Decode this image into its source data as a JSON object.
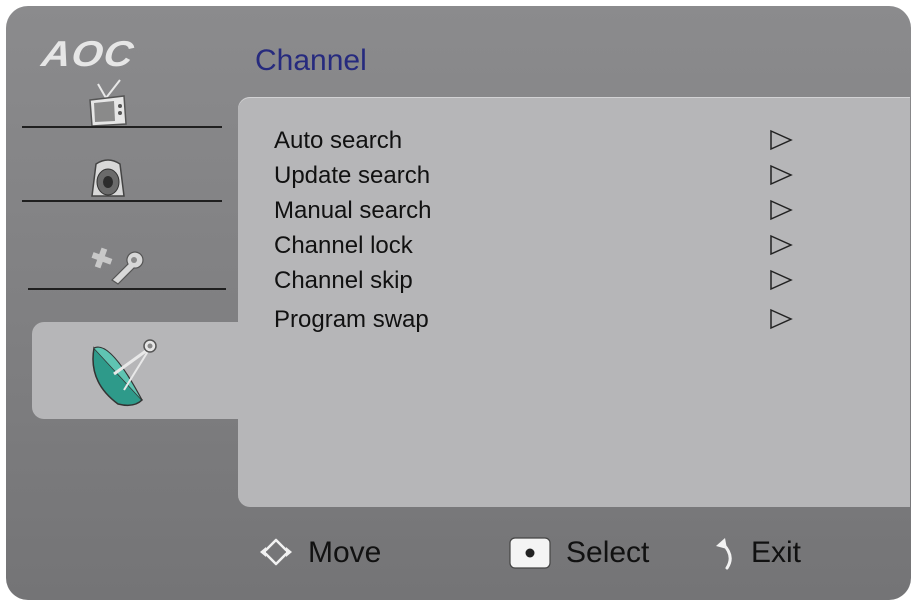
{
  "brand": {
    "logo_text": "AOC"
  },
  "header": {
    "title": "Channel"
  },
  "sidebar": {
    "items": [
      {
        "name": "tv-icon"
      },
      {
        "name": "speaker-icon"
      },
      {
        "name": "tools-icon"
      },
      {
        "name": "satellite-dish-icon",
        "active": true
      }
    ]
  },
  "menu": {
    "items": [
      {
        "label": "Auto search"
      },
      {
        "label": "Update search"
      },
      {
        "label": "Manual search"
      },
      {
        "label": "Channel lock"
      },
      {
        "label": "Channel skip"
      },
      {
        "label": "Program swap"
      }
    ]
  },
  "footer": {
    "move_label": "Move",
    "select_label": "Select",
    "exit_label": "Exit"
  },
  "colors": {
    "background": "#7e7e80",
    "panel": "#b6b6b8",
    "title": "#262a7e"
  }
}
